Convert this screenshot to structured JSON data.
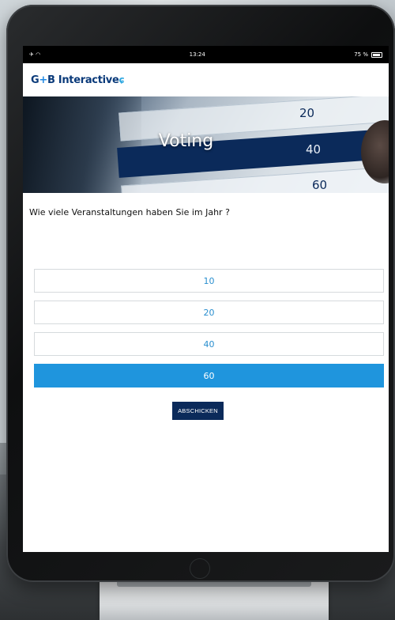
{
  "status_bar": {
    "left_icons": "✈ ◠",
    "time": "13:24",
    "battery_text": "75 %"
  },
  "header": {
    "logo_prefix": "G",
    "logo_plus": "+",
    "logo_text": "B Interactive",
    "logo_mark": "ɕ"
  },
  "hero": {
    "title": "Voting",
    "bg_values": [
      "20",
      "40",
      "60"
    ]
  },
  "question": "Wie viele Veranstaltungen haben Sie im Jahr ?",
  "options": [
    {
      "label": "10",
      "selected": false
    },
    {
      "label": "20",
      "selected": false
    },
    {
      "label": "40",
      "selected": false
    },
    {
      "label": "60",
      "selected": true
    }
  ],
  "submit_label": "ABSCHICKEN",
  "colors": {
    "accent": "#1f95dd",
    "brand": "#0b2a5a"
  }
}
